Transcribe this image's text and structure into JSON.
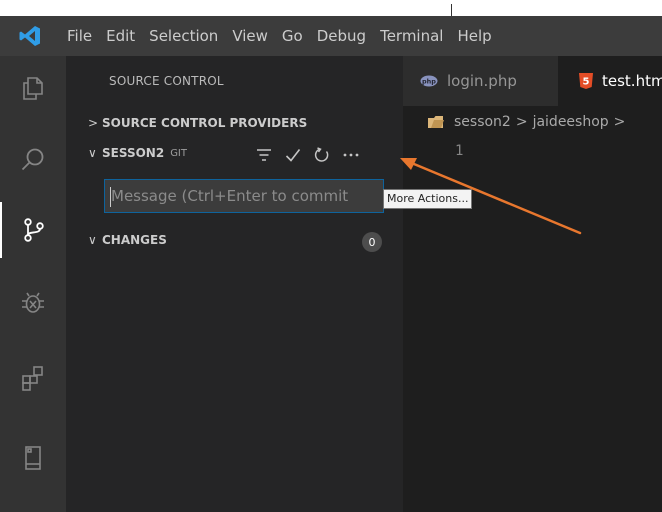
{
  "menu": [
    "File",
    "Edit",
    "Selection",
    "View",
    "Go",
    "Debug",
    "Terminal",
    "Help"
  ],
  "activity_bar": [
    "explorer-icon",
    "search-icon",
    "source-control-icon",
    "debug-icon",
    "extensions-icon",
    "remote-icon"
  ],
  "sidebar": {
    "title": "SOURCE CONTROL",
    "providers_label": "SOURCE CONTROL PROVIDERS",
    "repo_name": "SESSON2",
    "repo_type": "GIT",
    "commit_placeholder": "Message (Ctrl+Enter to commit",
    "changes_label": "CHANGES",
    "changes_count": "0"
  },
  "tooltip": "More Actions...",
  "tabs": [
    {
      "label": "login.php",
      "icon": "php-icon"
    },
    {
      "label": "test.html",
      "icon": "html5-icon"
    }
  ],
  "breadcrumb": [
    "sesson2",
    "jaideeshop",
    ""
  ],
  "line_number": "1",
  "colors": {
    "accent": "#0e639c",
    "annotation_arrow": "#e8772e",
    "html_icon": "#e44d26",
    "php_icon": "#8993be",
    "folder_icon": "#dcb67a"
  }
}
